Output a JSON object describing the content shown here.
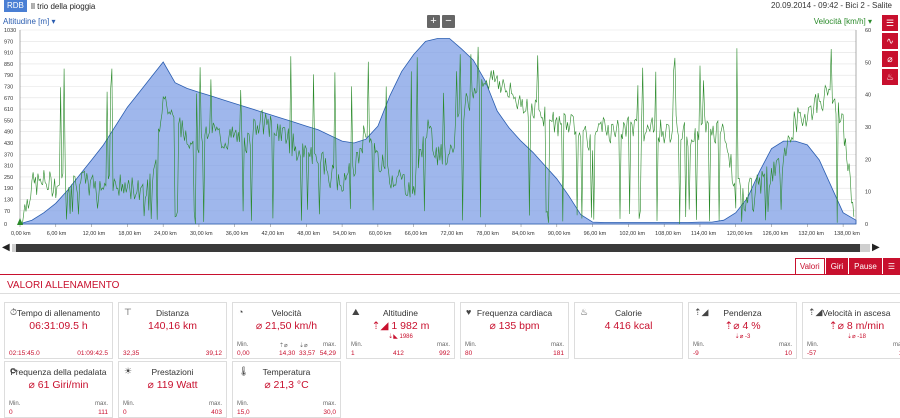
{
  "topbar": {
    "badge": "RDB",
    "title": "Il trio della pioggia",
    "info": "20.09.2014  -  09:42  -  Bici 2  -  Salite"
  },
  "chart": {
    "left_title": "Altitudine [m]",
    "right_title": "Velocità [km/h]",
    "zoom_in": "+",
    "zoom_out": "−"
  },
  "colors": {
    "accent": "#c8102e",
    "altitude": "#7f9fe6",
    "speed": "#2a8a2a"
  },
  "chart_data": {
    "type": "area",
    "xlabel": "",
    "x_ticks": [
      "0,00 km",
      "6,00 km",
      "12,00 km",
      "18,00 km",
      "24,00 km",
      "30,00 km",
      "36,00 km",
      "42,00 km",
      "48,00 km",
      "54,00 km",
      "60,00 km",
      "66,00 km",
      "72,00 km",
      "78,00 km",
      "84,00 km",
      "90,00 km",
      "96,00 km",
      "102,00 km",
      "108,00 km",
      "114,00 km",
      "120,00 km",
      "126,00 km",
      "132,00 km",
      "138,00 km"
    ],
    "y_left_ticks": [
      "0",
      "70",
      "130",
      "190",
      "250",
      "310",
      "370",
      "430",
      "490",
      "550",
      "610",
      "670",
      "730",
      "790",
      "850",
      "910",
      "970",
      "1030"
    ],
    "y_right_ticks": [
      "0",
      "10",
      "20",
      "30",
      "40",
      "50",
      "60"
    ],
    "ylim_left": [
      0,
      1030
    ],
    "ylim_right": [
      0,
      60
    ],
    "xlim": [
      0,
      140.16
    ],
    "series": [
      {
        "name": "Altitudine [m]",
        "x": [
          0,
          2,
          4,
          6,
          8,
          10,
          12,
          14,
          16,
          18,
          20,
          22,
          24,
          26,
          28,
          30,
          32,
          34,
          36,
          38,
          40,
          42,
          44,
          46,
          48,
          50,
          52,
          54,
          56,
          58,
          60,
          62,
          64,
          66,
          68,
          70,
          72,
          74,
          76,
          78,
          80,
          82,
          84,
          86,
          88,
          90,
          92,
          94,
          96,
          98,
          100,
          102,
          104,
          106,
          108,
          110,
          112,
          114,
          116,
          118,
          120,
          122,
          124,
          126,
          128,
          130,
          132,
          134,
          136,
          138,
          140.16
        ],
        "y": [
          1,
          20,
          60,
          110,
          180,
          260,
          340,
          420,
          520,
          620,
          700,
          780,
          860,
          750,
          720,
          700,
          680,
          660,
          640,
          620,
          600,
          580,
          560,
          540,
          520,
          500,
          470,
          440,
          430,
          450,
          520,
          680,
          810,
          900,
          970,
          985,
          985,
          930,
          870,
          760,
          600,
          510,
          440,
          380,
          310,
          240,
          150,
          50,
          10,
          8,
          8,
          8,
          8,
          8,
          8,
          8,
          8,
          10,
          10,
          20,
          60,
          140,
          280,
          400,
          440,
          440,
          420,
          340,
          200,
          60,
          20
        ]
      },
      {
        "name": "Velocità [km/h]",
        "x": [
          0,
          2,
          4,
          6,
          8,
          10,
          12,
          14,
          16,
          18,
          20,
          22,
          24,
          26,
          28,
          30,
          32,
          34,
          36,
          38,
          40,
          42,
          44,
          46,
          48,
          50,
          52,
          54,
          56,
          58,
          60,
          62,
          64,
          66,
          68,
          70,
          72,
          74,
          76,
          78,
          80,
          82,
          84,
          86,
          88,
          90,
          92,
          94,
          96,
          98,
          100,
          102,
          104,
          106,
          108,
          110,
          112,
          114,
          116,
          118,
          120,
          122,
          124,
          126,
          128,
          130,
          132,
          134,
          136,
          138,
          140
        ],
        "y": [
          0,
          12,
          13,
          12,
          13,
          13,
          12,
          12,
          12,
          11,
          11,
          13,
          40,
          30,
          28,
          25,
          30,
          26,
          27,
          25,
          32,
          30,
          28,
          24,
          20,
          22,
          15,
          14,
          16,
          30,
          20,
          15,
          14,
          10,
          30,
          22,
          20,
          35,
          40,
          45,
          45,
          40,
          38,
          36,
          34,
          30,
          32,
          30,
          25,
          30,
          28,
          30,
          28,
          30,
          28,
          30,
          27,
          30,
          29,
          27,
          12,
          10,
          12,
          15,
          20,
          32,
          34,
          38,
          40,
          30,
          0
        ]
      }
    ]
  },
  "side_icons": [
    "list-icon",
    "chart-line-icon",
    "no-speed-icon",
    "hr-icon"
  ],
  "scroll": {
    "left": "◀",
    "right": "▶"
  },
  "tabs": [
    "Valori",
    "Giri",
    "Pause"
  ],
  "section_title": "VALORI ALLENAMENTO",
  "cards": [
    {
      "title": "Tempo di allenamento",
      "value": "06:31:09.5 h",
      "icon": "⏱",
      "min_label": "",
      "max_label": "",
      "min": "02:15:45.0",
      "max": "01:09:42.5"
    },
    {
      "title": "Distanza",
      "value": "140,16 km",
      "icon": "⊤",
      "min_label": "",
      "max_label": "",
      "min": "32,35",
      "max": "39,12"
    },
    {
      "title": "Velocità",
      "value": "⌀ 21,50 km/h",
      "icon": "◔",
      "min_label": "Min.",
      "max_label": "max.",
      "min": "0,00",
      "max": "54,29",
      "mid1_label": "⇡⌀",
      "mid2_label": "⇣⌀",
      "mid1": "14,30",
      "mid2": "33,57"
    },
    {
      "title": "Altitudine",
      "value": "⇡◢ 1 982 m",
      "sub": "⇣◣ 1986",
      "icon": "⛰",
      "min_label": "Min.",
      "max_label": "max.",
      "min": "1",
      "mid1": "412",
      "max": "992"
    },
    {
      "title": "Frequenza cardiaca",
      "value": "⌀ 135 bpm",
      "icon": "♥",
      "min_label": "Min.",
      "max_label": "max.",
      "min": "80",
      "max": "181"
    },
    {
      "title": "Calorie",
      "value": "4 416 kcal",
      "icon": "♨",
      "min_label": "",
      "max_label": "",
      "min": "",
      "max": ""
    },
    {
      "title": "Pendenza",
      "value": "⇡⌀ 4 %",
      "sub": "⇣⌀ -3",
      "icon": "⇡◢",
      "min_label": "Min.",
      "max_label": "max.",
      "min": "-9",
      "max": "10"
    },
    {
      "title": "Velocità in ascesa",
      "value": "⇡⌀ 8 m/min",
      "sub": "⇣⌀ -18",
      "icon": "⇡◢",
      "min_label": "Min.",
      "max_label": "max.",
      "min": "-57",
      "max": "18"
    },
    {
      "title": "Frequenza della pedalata",
      "value": "⌀ 61 Giri/min",
      "icon": "⟳",
      "min_label": "Min.",
      "max_label": "max.",
      "min": "0",
      "max": "111"
    },
    {
      "title": "Prestazioni",
      "value": "⌀ 119 Watt",
      "icon": "☀",
      "min_label": "Min.",
      "max_label": "max.",
      "min": "0",
      "max": "403"
    },
    {
      "title": "Temperatura",
      "value": "⌀ 21,3 °C",
      "icon": "🌡",
      "min_label": "Min.",
      "max_label": "max.",
      "min": "15,0",
      "max": "30,0"
    }
  ]
}
